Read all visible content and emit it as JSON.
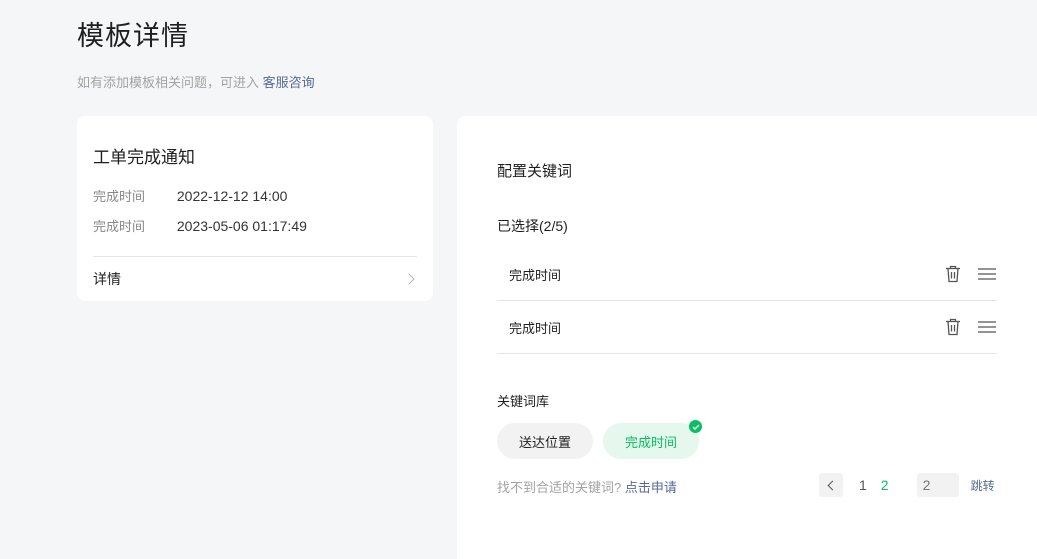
{
  "page": {
    "title": "模板详情",
    "subtitle_prefix": "如有添加模板相关问题，可进入",
    "subtitle_link": "客服咨询"
  },
  "template_card": {
    "name": "工单完成通知",
    "rows": [
      {
        "label": "完成时间",
        "value": "2022-12-12 14:00"
      },
      {
        "label": "完成时间",
        "value": "2023-05-06 01:17:49"
      }
    ],
    "detail_label": "详情"
  },
  "config": {
    "title": "配置关键词",
    "selected_label": "已选择(2/5)",
    "selected": [
      {
        "label": "完成时间"
      },
      {
        "label": "完成时间"
      }
    ],
    "library_label": "关键词库",
    "library_tags": [
      {
        "label": "送达位置",
        "selected": false
      },
      {
        "label": "完成时间",
        "selected": true
      }
    ],
    "notfound_text": "找不到合适的关键词?",
    "apply_link": "点击申请",
    "pagination": {
      "pages": [
        "1",
        "2"
      ],
      "current": "2",
      "jump_placeholder": "2",
      "jump_label": "跳转"
    }
  },
  "colors": {
    "accent": "#07c160",
    "link": "#576b95",
    "background": "#f5f6f7"
  },
  "icons": {
    "delete": "trash-icon",
    "drag": "drag-handle-icon",
    "check": "check-icon",
    "chevron_right": "chevron-right-icon",
    "chevron_left": "chevron-left-icon"
  }
}
